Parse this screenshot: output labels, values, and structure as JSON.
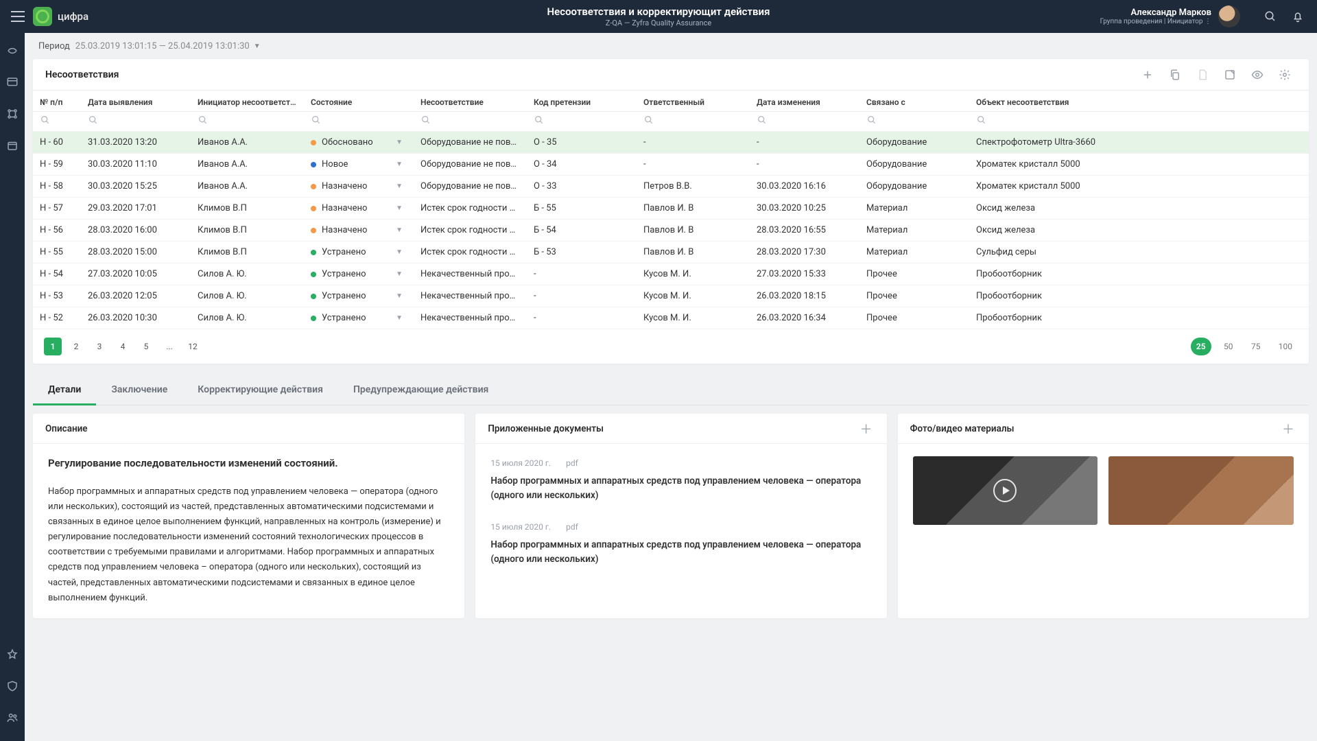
{
  "header": {
    "brand": "цифра",
    "title": "Несоответствия и корректирующит действия",
    "subtitle": "Z-QA — Zyfra Quality Assurance",
    "user_name": "Александр Марков",
    "user_role": "Группа проведения | Инициатор  ⋮"
  },
  "period": {
    "label": "Период",
    "value": "25.03.2019 13:01:15 — 25.04.2019 13:01:30"
  },
  "table": {
    "title": "Несоответствия",
    "cols": [
      "№ п/п",
      "Дата выявления",
      "Инициатор несоответствия",
      "Состояние",
      "Несоответствие",
      "Код претензии",
      "Ответственный",
      "Дата изменения",
      "Связано с",
      "Объект несоответствия"
    ],
    "rows": [
      {
        "n": "Н - 60",
        "date": "31.03.2020 13:20",
        "init": "Иванов А.А.",
        "state": "Обосновано",
        "sc": "#f2994a",
        "nc": "Оборудование не поверено",
        "code": "О - 35",
        "resp": "-",
        "chg": "-",
        "rel": "Оборудование",
        "obj": "Спектрофотометр Ultra-3660",
        "sel": true
      },
      {
        "n": "Н - 59",
        "date": "30.03.2020 11:10",
        "init": "Иванов А.А.",
        "state": "Новое",
        "sc": "#2f6fd0",
        "nc": "Оборудование не поверено",
        "code": "О - 34",
        "resp": "-",
        "chg": "-",
        "rel": "Оборудование",
        "obj": "Хроматек кристалл 5000"
      },
      {
        "n": "Н - 58",
        "date": "30.03.2020 15:25",
        "init": "Иванов А.А.",
        "state": "Назначено",
        "sc": "#f2994a",
        "nc": "Оборудование не поверено",
        "code": "О - 33",
        "resp": "Петров В.В.",
        "chg": "30.03.2020 16:16",
        "rel": "Оборудование",
        "obj": "Хроматек кристалл 5000"
      },
      {
        "n": "Н - 57",
        "date": "29.03.2020 17:01",
        "init": "Климов В.П",
        "state": "Назначено",
        "sc": "#f2994a",
        "nc": "Истек срок годности реактив",
        "code": "Б - 55",
        "resp": "Павлов И. В",
        "chg": "30.03.2020 10:25",
        "rel": "Материал",
        "obj": "Оксид железа"
      },
      {
        "n": "Н - 56",
        "date": "28.03.2020 16:00",
        "init": "Климов В.П",
        "state": "Назначено",
        "sc": "#f2994a",
        "nc": "Истек срок годности реактив",
        "code": "Б - 54",
        "resp": "Павлов И. В",
        "chg": "28.03.2020 16:55",
        "rel": "Материал",
        "obj": "Оксид железа"
      },
      {
        "n": "Н - 55",
        "date": "28.03.2020 15:00",
        "init": "Климов В.П",
        "state": "Устранено",
        "sc": "#27ae60",
        "nc": "Истек срок годности реактив",
        "code": "Б - 53",
        "resp": "Павлов И. В",
        "chg": "28.03.2020 17:30",
        "rel": "Материал",
        "obj": "Сульфид серы"
      },
      {
        "n": "Н - 54",
        "date": "27.03.2020 10:05",
        "init": "Силов А. Ю.",
        "state": "Устранено",
        "sc": "#27ae60",
        "nc": "Некачественный пробоотбор",
        "code": "-",
        "resp": "Кусов М. И.",
        "chg": "27.03.2020 15:33",
        "rel": "Прочее",
        "obj": "Пробоотборник"
      },
      {
        "n": "Н - 53",
        "date": "26.03.2020 12:05",
        "init": "Силов А. Ю.",
        "state": "Устранено",
        "sc": "#27ae60",
        "nc": "Некачественный пробоотбор",
        "code": "-",
        "resp": "Кусов М. И.",
        "chg": "26.03.2020 18:15",
        "rel": "Прочее",
        "obj": "Пробоотборник"
      },
      {
        "n": "Н - 52",
        "date": "26.03.2020 10:30",
        "init": "Силов А. Ю.",
        "state": "Устранено",
        "sc": "#27ae60",
        "nc": "Некачественный пробоотбор",
        "code": "-",
        "resp": "Кусов М. И.",
        "chg": "26.03.2020 16:34",
        "rel": "Прочее",
        "obj": "Пробоотборник"
      }
    ]
  },
  "pager": {
    "pages": [
      "1",
      "2",
      "3",
      "4",
      "5",
      "...",
      "12"
    ],
    "sizes": [
      "25",
      "50",
      "75",
      "100"
    ]
  },
  "tabs": [
    "Детали",
    "Заключение",
    "Корректирующие действия",
    "Предупреждающие действия"
  ],
  "details": {
    "desc_title": "Описание",
    "heading": "Регулирование последовательности изменений состояний.",
    "body": "Набор программных и аппаратных средств под управлением человека — оператора (одного или нескольких), состоящий из частей, представленных автоматическими подсистемами и связанных в единое целое выполнением функций, направленных на контроль (измерение) и регулирование последовательности изменений состояний технологических процессов в соответствии с требуемыми правилами и алгоритмами. Набор программных и аппаратных средств под управлением человека – оператора (одного или нескольких), состоящий из частей, представленных автоматическими подсистемами и связанных в единое целое выполнением функций.",
    "docs_title": "Приложенные документы",
    "docs": [
      {
        "date": "15 июля 2020 г.",
        "ext": "pdf",
        "title": "Набор программных и аппаратных средств под управлением человека — оператора (одного или нескольких)"
      },
      {
        "date": "15 июля 2020 г.",
        "ext": "pdf",
        "title": "Набор программных и аппаратных средств под управлением человека — оператора (одного или нескольких)"
      }
    ],
    "media_title": "Фото/видео материалы"
  }
}
